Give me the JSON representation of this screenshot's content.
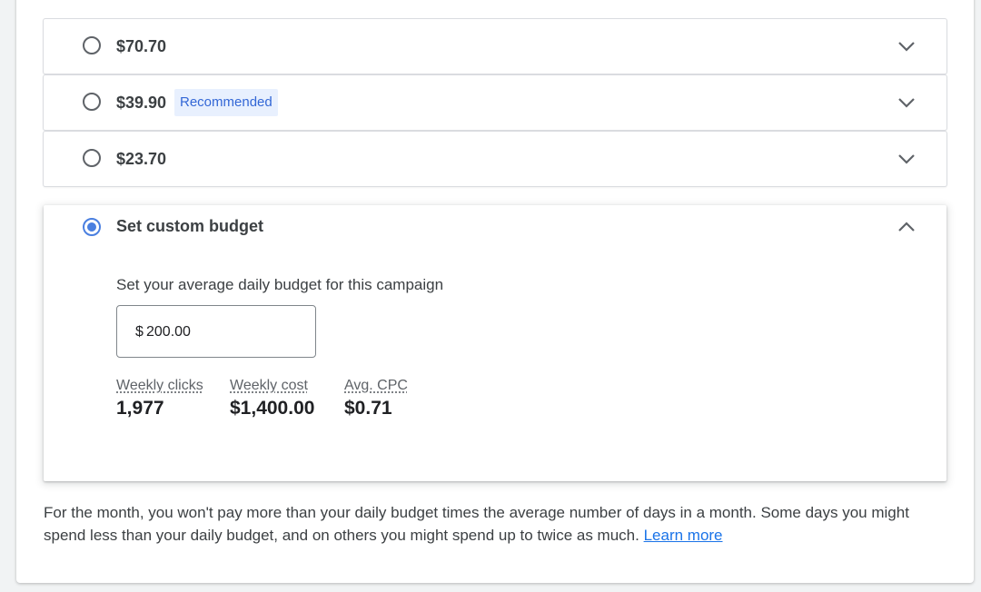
{
  "budget_options": [
    {
      "amount": "$70.70",
      "badge": ""
    },
    {
      "amount": "$39.90",
      "badge": "Recommended"
    },
    {
      "amount": "$23.70",
      "badge": ""
    }
  ],
  "custom_budget": {
    "label": "Set custom budget",
    "selected": true,
    "instruction": "Set your average daily budget for this campaign",
    "currency_symbol": "$",
    "value": "200.00",
    "metrics": [
      {
        "label": "Weekly clicks",
        "value": "1,977"
      },
      {
        "label": "Weekly cost",
        "value": "$1,400.00"
      },
      {
        "label": "Avg. CPC",
        "value": "$0.71"
      }
    ]
  },
  "footnote": {
    "text": "For the month, you won't pay more than your daily budget times the average number of days in a month. Some days you might spend less than your daily budget, and on others you might spend up to twice as much. ",
    "link": "Learn more"
  },
  "colors": {
    "accent": "#4a7fe0",
    "link": "#1a73e8",
    "badge_bg": "#e8f0fe",
    "badge_text": "#3367d6"
  },
  "icons": {
    "collapsed": "chevron-down-icon",
    "expanded": "chevron-up-icon"
  }
}
